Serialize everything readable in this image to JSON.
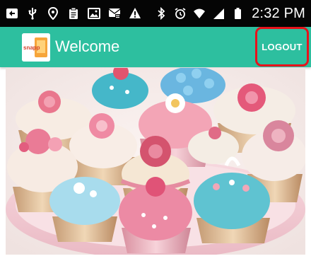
{
  "status_bar": {
    "time": "2:32 PM",
    "icons": [
      "image-notification-icon",
      "usb-icon",
      "location-icon",
      "clipboard-icon",
      "gallery-icon",
      "message-icon",
      "warning-icon",
      "bluetooth-icon",
      "alarm-icon",
      "wifi-icon",
      "signal-icon",
      "battery-icon"
    ]
  },
  "app_bar": {
    "title": "Welcome",
    "logo_text": "snapp",
    "logout_label": "LOGOUT",
    "background_color": "#2dbf9f",
    "highlight_color": "#e8121b"
  },
  "hero": {
    "subject": "cupcakes-photo-icon"
  }
}
